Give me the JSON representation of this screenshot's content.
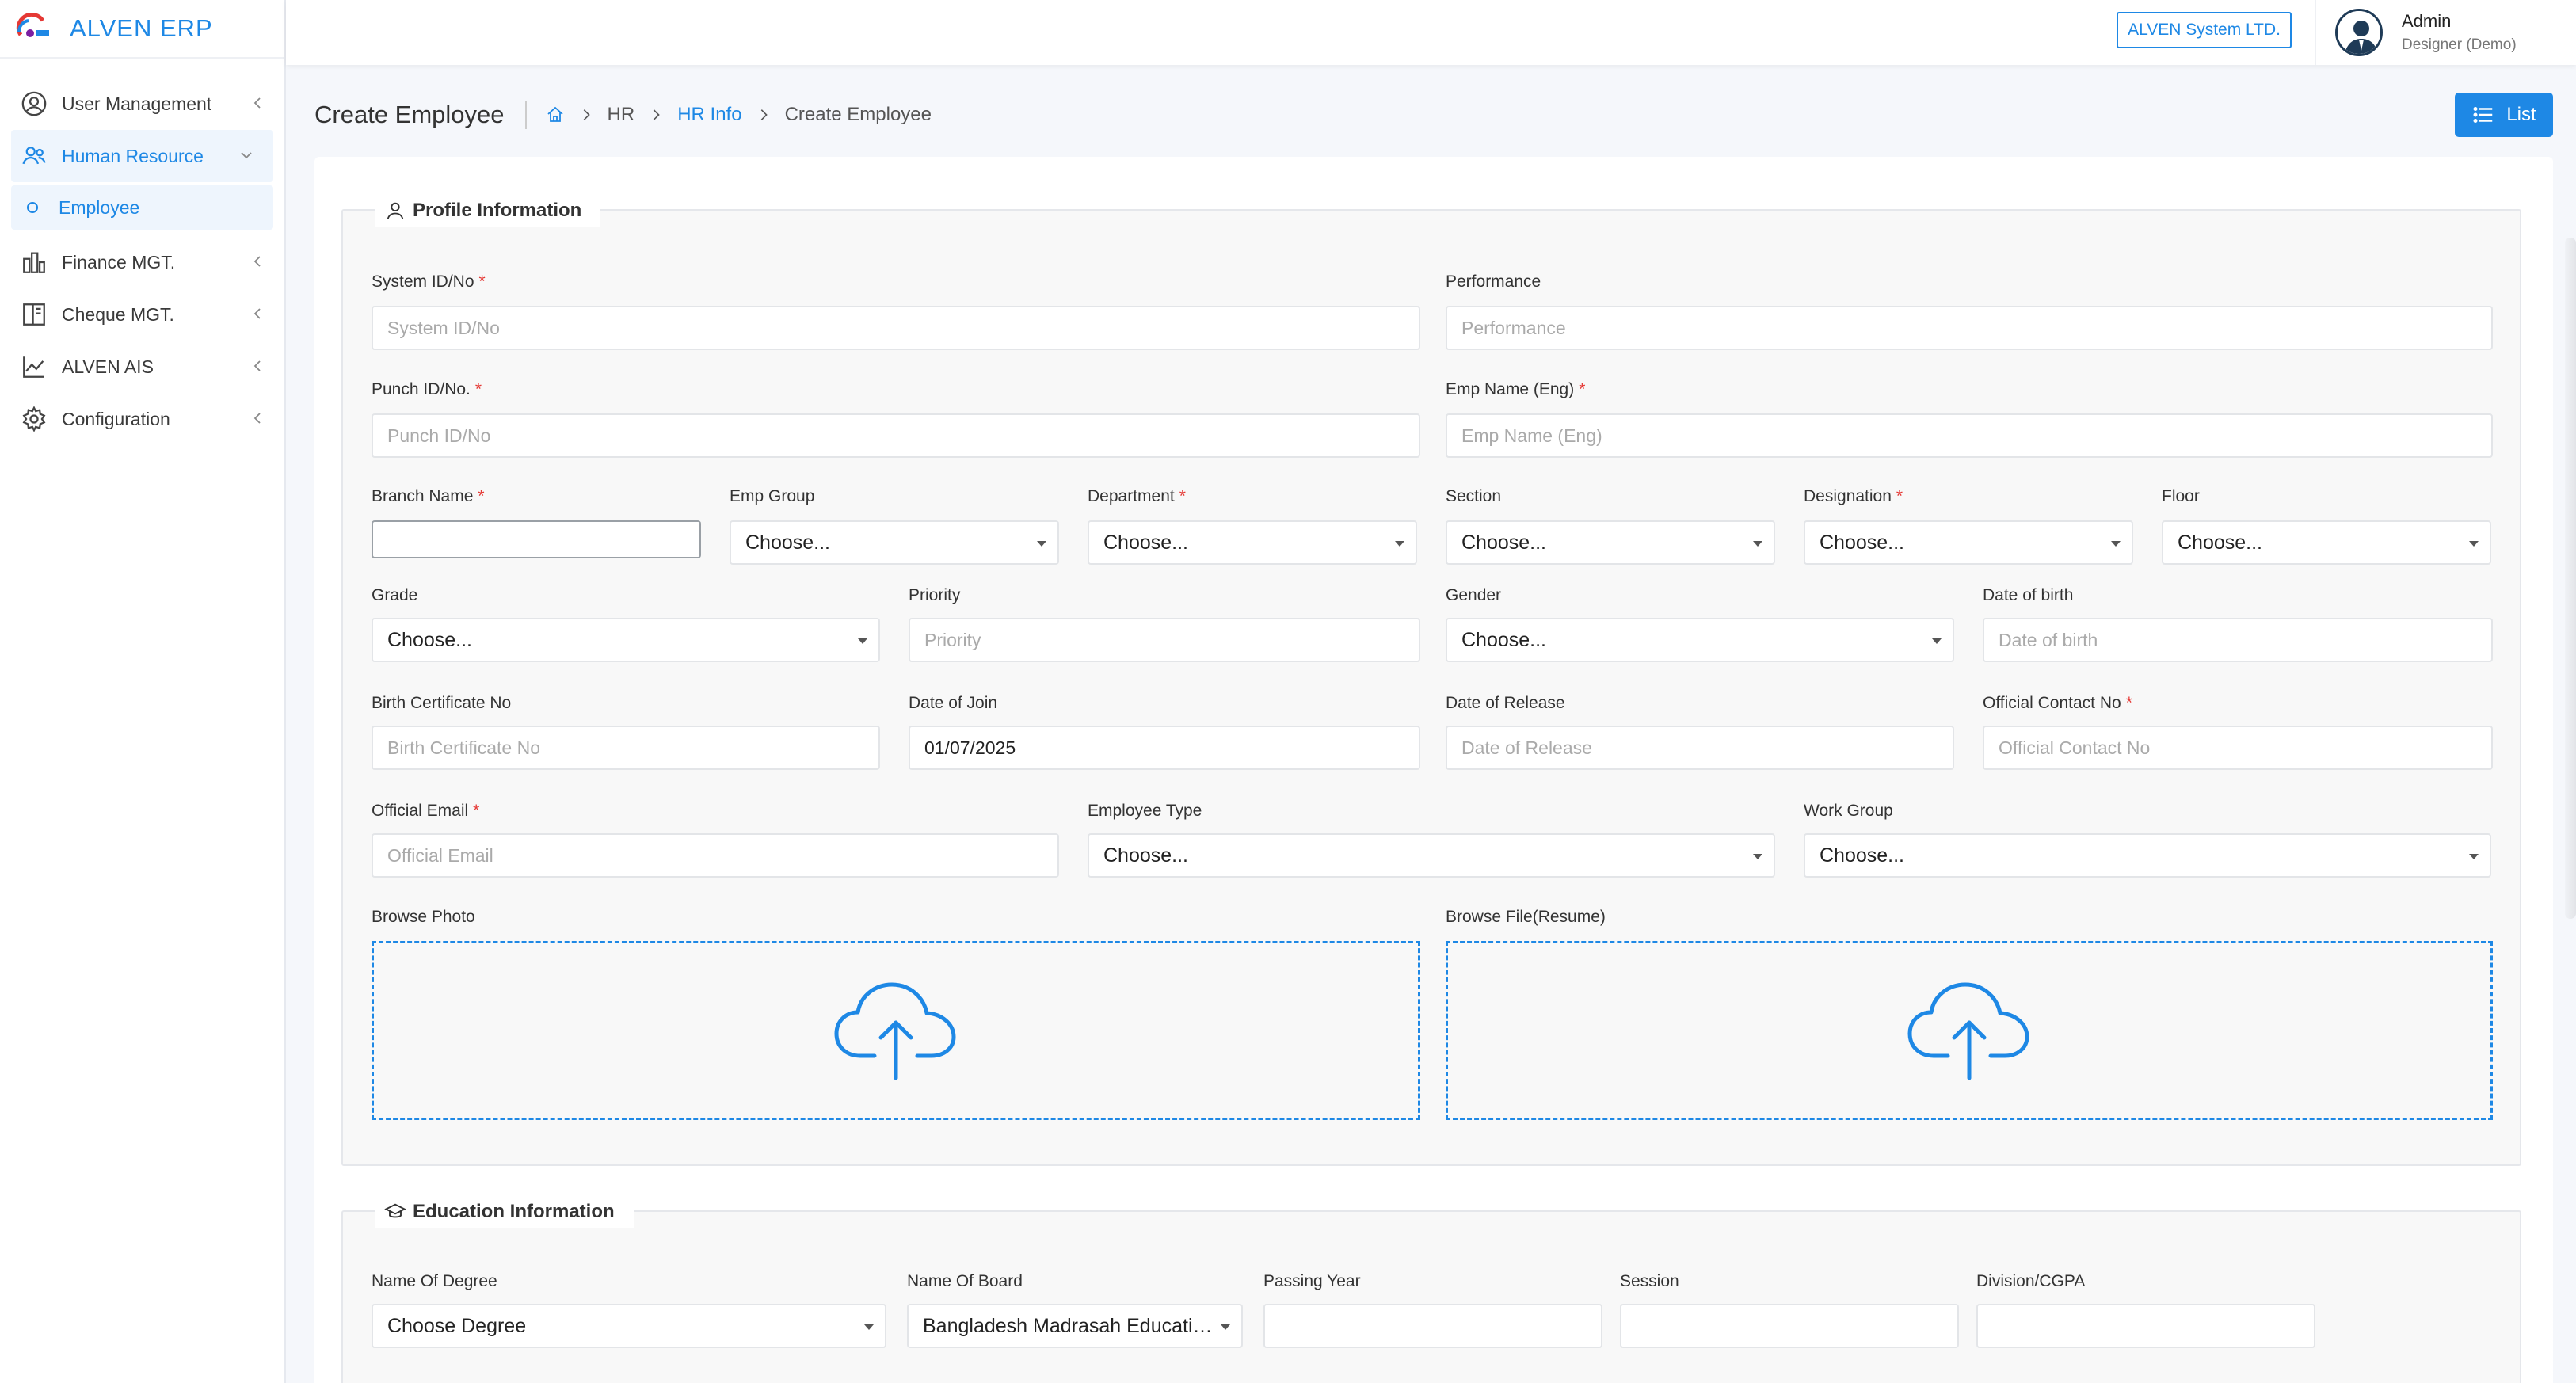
{
  "brand": {
    "name": "ALVEN ERP"
  },
  "sidebar": {
    "items": [
      {
        "label": "User Management",
        "icon": "user-circle-icon"
      },
      {
        "label": "Human Resource",
        "icon": "users-icon",
        "active": true
      },
      {
        "label": "Employee",
        "icon": "circle-icon"
      },
      {
        "label": "Finance MGT.",
        "icon": "bar-chart-icon"
      },
      {
        "label": "Cheque MGT.",
        "icon": "book-icon"
      },
      {
        "label": "ALVEN AIS",
        "icon": "line-chart-icon"
      },
      {
        "label": "Configuration",
        "icon": "gear-icon"
      }
    ]
  },
  "topbar": {
    "company": "ALVEN System LTD.",
    "user": {
      "name": "Admin",
      "role": "Designer (Demo)"
    }
  },
  "header": {
    "title": "Create Employee",
    "breadcrumb": [
      "HR",
      "HR Info",
      "Create Employee"
    ],
    "list_button": "List"
  },
  "profile": {
    "title": "Profile Information",
    "fields": {
      "system_id": {
        "label": "System ID/No",
        "placeholder": "System ID/No"
      },
      "performance": {
        "label": "Performance",
        "placeholder": "Performance"
      },
      "punch_id": {
        "label": "Punch ID/No.",
        "placeholder": "Punch ID/No"
      },
      "emp_name": {
        "label": "Emp Name (Eng)",
        "placeholder": "Emp Name (Eng)"
      },
      "branch": {
        "label": "Branch Name",
        "value": ""
      },
      "emp_group": {
        "label": "Emp Group",
        "value": "Choose..."
      },
      "department": {
        "label": "Department",
        "value": "Choose..."
      },
      "section": {
        "label": "Section",
        "value": "Choose..."
      },
      "designation": {
        "label": "Designation",
        "value": "Choose..."
      },
      "floor": {
        "label": "Floor",
        "value": "Choose..."
      },
      "grade": {
        "label": "Grade",
        "value": "Choose..."
      },
      "priority": {
        "label": "Priority",
        "placeholder": "Priority"
      },
      "gender": {
        "label": "Gender",
        "value": "Choose..."
      },
      "dob": {
        "label": "Date of birth",
        "placeholder": "Date of birth"
      },
      "birth_cert": {
        "label": "Birth Certificate No",
        "placeholder": "Birth Certificate No"
      },
      "doj": {
        "label": "Date of Join",
        "value": "01/07/2025"
      },
      "dor": {
        "label": "Date of Release",
        "placeholder": "Date of Release"
      },
      "contact": {
        "label": "Official Contact No",
        "placeholder": "Official Contact No"
      },
      "email": {
        "label": "Official Email",
        "placeholder": "Official Email"
      },
      "emp_type": {
        "label": "Employee Type",
        "value": "Choose..."
      },
      "work_group": {
        "label": "Work Group",
        "value": "Choose..."
      },
      "photo": {
        "label": "Browse Photo"
      },
      "resume": {
        "label": "Browse File(Resume)"
      }
    }
  },
  "education": {
    "title": "Education Information",
    "fields": {
      "degree": {
        "label": "Name Of Degree",
        "value": "Choose Degree"
      },
      "board": {
        "label": "Name Of Board",
        "value": "Bangladesh Madrasah Education Board"
      },
      "passing_year": {
        "label": "Passing Year",
        "value": ""
      },
      "session": {
        "label": "Session",
        "value": ""
      },
      "division": {
        "label": "Division/CGPA",
        "value": ""
      }
    }
  },
  "colors": {
    "accent": "#1e88e5",
    "required": "#e53935"
  }
}
